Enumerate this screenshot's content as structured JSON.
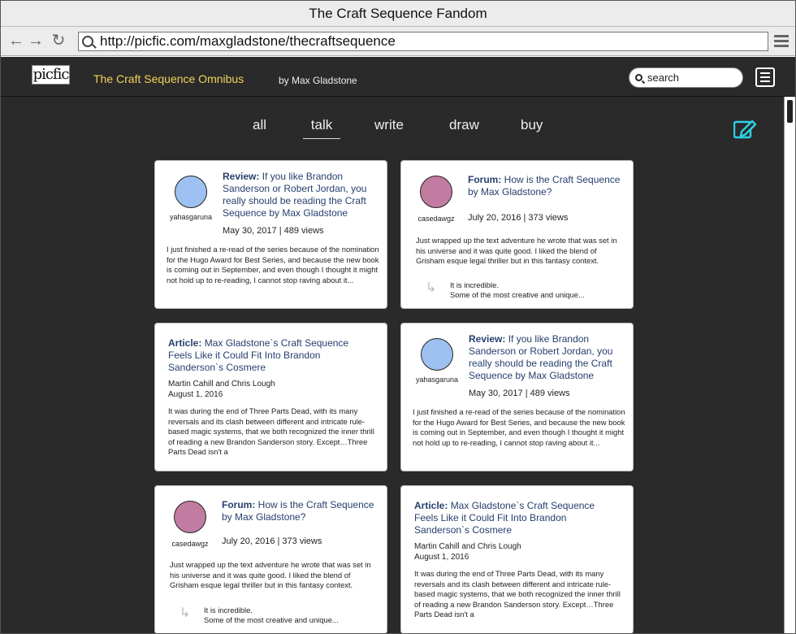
{
  "browser": {
    "title": "The Craft Sequence Fandom",
    "url": "http://picfic.com/maxgladstone/thecraftsequence"
  },
  "appbar": {
    "logo_text": "picfic",
    "book_title": "The Craft Sequence Omnibus",
    "author": "by Max Gladstone",
    "search_placeholder": "search"
  },
  "tabs": [
    "all",
    "talk",
    "write",
    "draw",
    "buy"
  ],
  "active_tab": "talk",
  "colors": {
    "accent_yellow": "#f2d25a",
    "compose_cyan": "#2ad4e6",
    "app_bg": "#2a2a2a",
    "avatar_blue": "#9dc1f0",
    "avatar_pink": "#c27ba1"
  },
  "cards": [
    {
      "type_label": "Review:",
      "title": "If you like Brandon Sanderson or Robert Jordan, you really should be reading the Craft Sequence by Max Gladstone",
      "user": "yahasgaruna",
      "meta": "May 30, 2017 | 489 views",
      "excerpt": "I just finished a re-read of the series because of the nomination for the Hugo Award for Best Series, and because the new book is coming out in September, and even though I thought it might not hold up to re-reading, I cannot stop raving about it..."
    },
    {
      "type_label": "Forum:",
      "title": "How is the Craft Sequence by Max Gladstone?",
      "user": "casedawgz",
      "meta": "July 20, 2016 | 373 views",
      "excerpt": "Just wrapped up the text adventure he wrote that was set in his universe and it was quite good. I liked the blend of Grisham esque legal thriller but in this fantasy context.",
      "reply1": "It is incredible.",
      "reply2": "Some of the most creative and unique..."
    },
    {
      "type_label": "Article:",
      "title": "Max Gladstone`s Craft Sequence Feels Like it Could Fit Into Brandon Sanderson`s Cosmere",
      "authors": "Martin Cahill and Chris Lough",
      "date": "August 1, 2016",
      "excerpt": "It was during the end of Three Parts Dead, with its many reversals and its clash between different and intricate rule-based magic systems, that we both recognized the inner thrill of reading a new Brandon Sanderson story. Except…Three Parts Dead isn't a"
    }
  ]
}
